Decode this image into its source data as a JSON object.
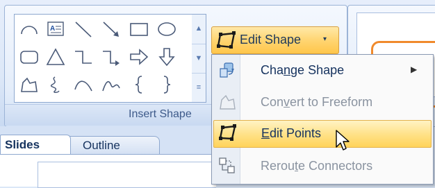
{
  "insert_shapes": {
    "group_label": "Insert Shape",
    "gallery_shapes": [
      {
        "icon": "arc-shape-icon"
      },
      {
        "icon": "text-box-shape-icon"
      },
      {
        "icon": "line-shape-icon"
      },
      {
        "icon": "arrow-line-shape-icon"
      },
      {
        "icon": "rectangle-shape-icon"
      },
      {
        "icon": "oval-shape-icon"
      },
      {
        "icon": "rounded-rectangle-shape-icon"
      },
      {
        "icon": "triangle-shape-icon"
      },
      {
        "icon": "elbow-connector-shape-icon"
      },
      {
        "icon": "elbow-arrow-connector-shape-icon"
      },
      {
        "icon": "right-arrow-shape-icon"
      },
      {
        "icon": "down-arrow-shape-icon"
      },
      {
        "icon": "freeform-shape-icon"
      },
      {
        "icon": "scribble-shape-icon"
      },
      {
        "icon": "curve-shape-icon"
      },
      {
        "icon": "wave-curve-shape-icon"
      },
      {
        "icon": "left-brace-shape-icon"
      },
      {
        "icon": "right-brace-shape-icon"
      }
    ]
  },
  "edit_shape": {
    "label": "Edit Shape",
    "dropdown_arrow": "▾"
  },
  "menu": {
    "items": [
      {
        "label_pre": "Cha",
        "label_u": "n",
        "label_post": "ge Shape",
        "enabled": true,
        "has_submenu": true,
        "submenu_arrow": "▶"
      },
      {
        "label_pre": "Con",
        "label_u": "v",
        "label_post": "ert to Freeform",
        "enabled": false
      },
      {
        "label_pre": "",
        "label_u": "E",
        "label_post": "dit Points",
        "enabled": true,
        "highlighted": true
      },
      {
        "label_pre": "Rerou",
        "label_u": "t",
        "label_post": "e Connectors",
        "enabled": false
      }
    ]
  },
  "pane_tabs": {
    "slides": "Slides",
    "outline": "Outline"
  },
  "colors": {
    "highlight": "#ffd572",
    "accent_orange": "#f08a2c",
    "ribbon_blue": "#dde8f8"
  }
}
